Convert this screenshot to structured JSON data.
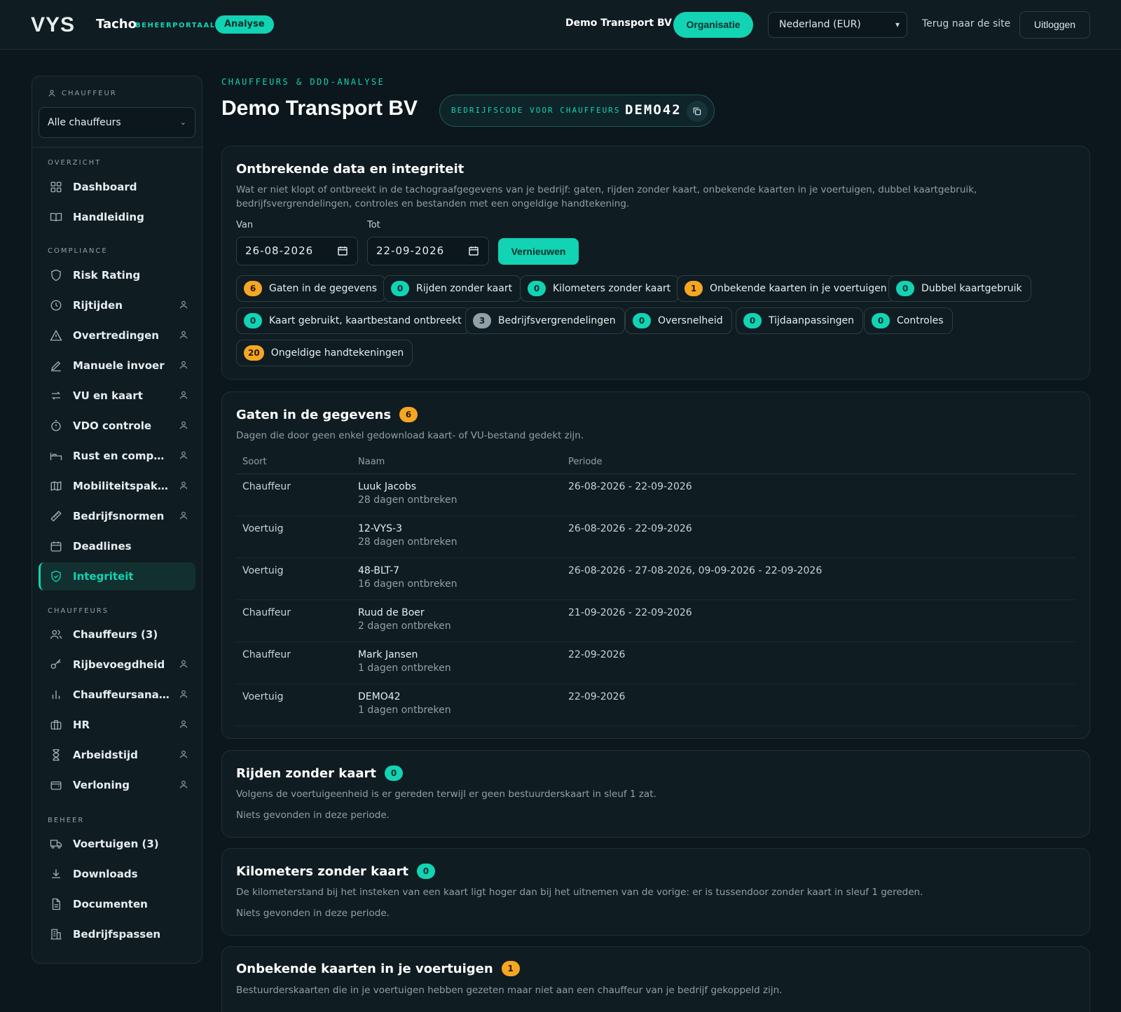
{
  "header": {
    "logo": "VYS",
    "brand": "Tacho",
    "brand_sub": "BEHEERPORTAAL",
    "analyse_label": "Analyse",
    "company": "Demo Transport BV",
    "org_button": "Organisatie",
    "country_select": "Nederland (EUR)",
    "back_link": "Terug naar de site",
    "logout": "Uitloggen"
  },
  "sidebar": {
    "chauffeur_head": "CHAUFFEUR",
    "chauffeur_select": "Alle chauffeurs",
    "sections": {
      "overzicht": "OVERZICHT",
      "compliance": "COMPLIANCE",
      "chauffeurs": "CHAUFFEURS",
      "beheer": "BEHEER"
    },
    "items": {
      "dashboard": "Dashboard",
      "handleiding": "Handleiding",
      "risk": "Risk Rating",
      "rijtijden": "Rijtijden",
      "overtredingen": "Overtredingen",
      "manuele": "Manuele invoer",
      "vu": "VU en kaart",
      "vdo": "VDO controle",
      "rust": "Rust en compensatie",
      "mobiliteit": "Mobiliteitspakket",
      "normen": "Bedrijfsnormen",
      "deadlines": "Deadlines",
      "integriteit": "Integriteit",
      "chauffeurs": "Chauffeurs (3)",
      "rijbevoegdheid": "Rijbevoegdheid",
      "analyse": "Chauffeursanalyse",
      "hr": "HR",
      "arbeidstijd": "Arbeidstijd",
      "verloning": "Verloning",
      "voertuigen": "Voertuigen (3)",
      "downloads": "Downloads",
      "documenten": "Documenten",
      "passen": "Bedrijfspassen"
    }
  },
  "main": {
    "kicker": "CHAUFFEURS & DDD-ANALYSE",
    "title": "Demo Transport BV",
    "code_label": "BEDRIJFSCODE VOOR CHAUFFEURS",
    "code_value": "DEMO42",
    "integrity": {
      "title": "Ontbrekende data en integriteit",
      "desc": "Wat er niet klopt of ontbreekt in de tachograafgegevens van je bedrijf: gaten, rijden zonder kaart, onbekende kaarten in je voertuigen, dubbel kaartgebruik, bedrijfsvergrendelingen, controles en bestanden met een ongeldige handtekening.",
      "from_label": "Van",
      "to_label": "Tot",
      "from_value": "26-08-2026",
      "to_value": "22-09-2026",
      "refresh": "Vernieuwen",
      "chips": [
        {
          "count": "6",
          "label": "Gaten in de gegevens"
        },
        {
          "count": "0",
          "label": "Rijden zonder kaart"
        },
        {
          "count": "0",
          "label": "Kilometers zonder kaart"
        },
        {
          "count": "1",
          "label": "Onbekende kaarten in je voertuigen"
        },
        {
          "count": "0",
          "label": "Dubbel kaartgebruik"
        },
        {
          "count": "0",
          "label": "Kaart gebruikt, kaartbestand ontbreekt"
        },
        {
          "count": "3",
          "label": "Bedrijfsvergrendelingen"
        },
        {
          "count": "0",
          "label": "Oversnelheid"
        },
        {
          "count": "0",
          "label": "Tijdaanpassingen"
        },
        {
          "count": "0",
          "label": "Controles"
        },
        {
          "count": "20",
          "label": "Ongeldige handtekeningen"
        }
      ]
    },
    "gaps": {
      "title": "Gaten in de gegevens",
      "count": "6",
      "desc": "Dagen die door geen enkel gedownload kaart- of VU-bestand gedekt zijn.",
      "columns": [
        "Soort",
        "Naam",
        "Periode"
      ],
      "rows": [
        {
          "soort": "Chauffeur",
          "naam": "Luuk Jacobs",
          "sub": "28 dagen ontbreken",
          "periode": "26-08-2026 - 22-09-2026"
        },
        {
          "soort": "Voertuig",
          "naam": "12-VYS-3",
          "sub": "28 dagen ontbreken",
          "periode": "26-08-2026 - 22-09-2026"
        },
        {
          "soort": "Voertuig",
          "naam": "48-BLT-7",
          "sub": "16 dagen ontbreken",
          "periode": "26-08-2026 - 27-08-2026, 09-09-2026 - 22-09-2026"
        },
        {
          "soort": "Chauffeur",
          "naam": "Ruud de Boer",
          "sub": "2 dagen ontbreken",
          "periode": "21-09-2026 - 22-09-2026"
        },
        {
          "soort": "Chauffeur",
          "naam": "Mark Jansen",
          "sub": "1 dagen ontbreken",
          "periode": "22-09-2026"
        },
        {
          "soort": "Voertuig",
          "naam": "DEMO42",
          "sub": "1 dagen ontbreken",
          "periode": "22-09-2026"
        }
      ]
    },
    "nocard": {
      "title": "Rijden zonder kaart",
      "count": "0",
      "desc": "Volgens de voertuigeenheid is er gereden terwijl er geen bestuurderskaart in sleuf 1 zat.",
      "empty": "Niets gevonden in deze periode."
    },
    "km": {
      "title": "Kilometers zonder kaart",
      "count": "0",
      "desc": "De kilometerstand bij het insteken van een kaart ligt hoger dan bij het uitnemen van de vorige: er is tussendoor zonder kaart in sleuf 1 gereden.",
      "empty": "Niets gevonden in deze periode."
    },
    "unknown": {
      "title": "Onbekende kaarten in je voertuigen",
      "count": "1",
      "desc": "Bestuurderskaarten die in je voertuigen hebben gezeten maar niet aan een chauffeur van je bedrijf gekoppeld zijn."
    }
  },
  "colors": {
    "accent": "#12d3b4",
    "warning": "#f5a623",
    "background": "#0c171d",
    "panel": "#0f1c22"
  }
}
